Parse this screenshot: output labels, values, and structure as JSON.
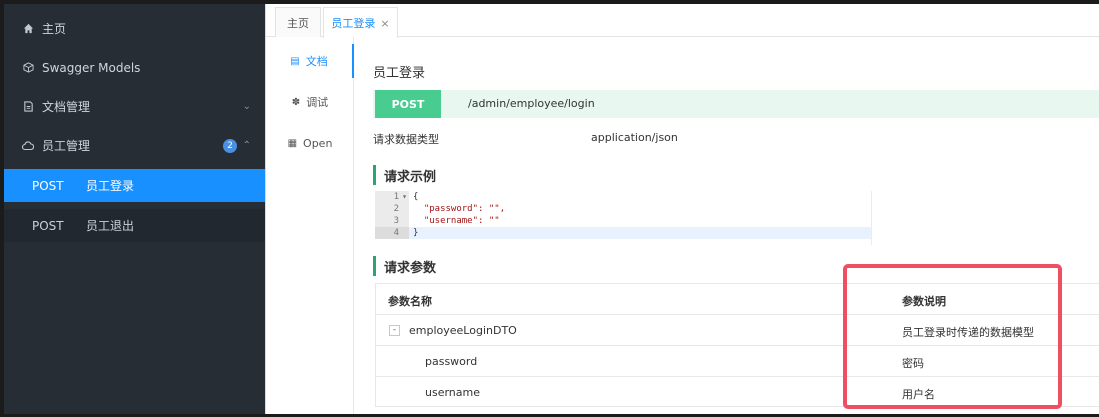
{
  "sidebar": {
    "items": [
      {
        "label": "主页",
        "icon": "home-icon"
      },
      {
        "label": "Swagger Models",
        "icon": "cube-icon"
      },
      {
        "label": "文档管理",
        "icon": "document-icon"
      },
      {
        "label": "员工管理",
        "icon": "cloud-icon",
        "badge": "2"
      }
    ],
    "sub_items": [
      {
        "method": "POST",
        "label": "员工登录"
      },
      {
        "method": "POST",
        "label": "员工退出"
      }
    ]
  },
  "tabs": [
    {
      "label": "主页"
    },
    {
      "label": "员工登录",
      "close": "×"
    }
  ],
  "doc_tabs": [
    {
      "label": "文档",
      "icon": "document-icon"
    },
    {
      "label": "调试",
      "icon": "bug-icon"
    },
    {
      "label": "Open",
      "icon": "file-icon"
    }
  ],
  "api": {
    "title": "员工登录",
    "method": "POST",
    "path": "/admin/employee/login",
    "request_type_label": "请求数据类型",
    "request_type_value": "application/json"
  },
  "example": {
    "heading": "请求示例",
    "lines": [
      "{",
      "  \"password\": \"\",",
      "  \"username\": \"\"",
      "}"
    ],
    "line_numbers": [
      "1",
      "2",
      "3",
      "4"
    ]
  },
  "params": {
    "heading": "请求参数",
    "headers": [
      "参数名称",
      "参数说明"
    ],
    "rows": [
      {
        "name": "employeeLoginDTO",
        "desc": "员工登录时传递的数据模型",
        "expand": "-"
      },
      {
        "name": "password",
        "desc": "密码"
      },
      {
        "name": "username",
        "desc": "用户名"
      }
    ]
  },
  "colors": {
    "accent": "#1890ff",
    "post": "#49cc90",
    "highlight": "#ee4f62",
    "sidebar": "#262d35"
  }
}
